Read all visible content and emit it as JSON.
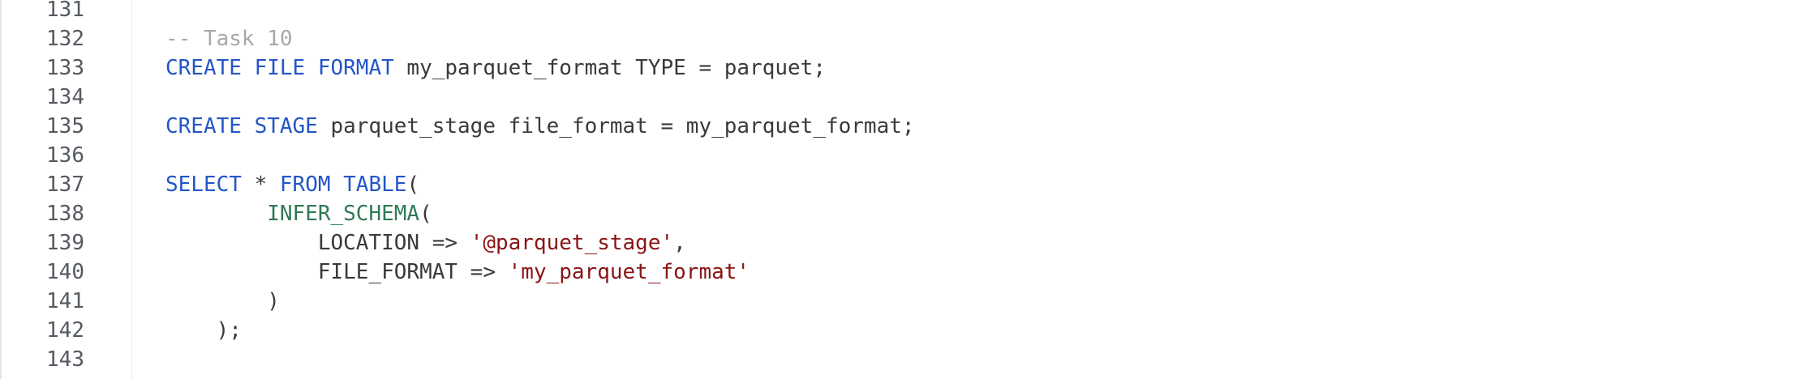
{
  "editor": {
    "lines": [
      {
        "number": "131",
        "tokens": []
      },
      {
        "number": "132",
        "tokens": [
          {
            "type": "cm",
            "text": "-- Task 10"
          }
        ]
      },
      {
        "number": "133",
        "tokens": [
          {
            "type": "kw",
            "text": "CREATE FILE FORMAT"
          },
          {
            "type": "id",
            "text": " my_parquet_format TYPE = parquet;"
          }
        ]
      },
      {
        "number": "134",
        "tokens": []
      },
      {
        "number": "135",
        "tokens": [
          {
            "type": "kw",
            "text": "CREATE STAGE"
          },
          {
            "type": "id",
            "text": " parquet_stage file_format = my_parquet_format;"
          }
        ]
      },
      {
        "number": "136",
        "tokens": []
      },
      {
        "number": "137",
        "tokens": [
          {
            "type": "kw",
            "text": "SELECT"
          },
          {
            "type": "id",
            "text": " * "
          },
          {
            "type": "kw",
            "text": "FROM TABLE"
          },
          {
            "type": "id",
            "text": "("
          }
        ]
      },
      {
        "number": "138",
        "tokens": [
          {
            "type": "id",
            "text": "        "
          },
          {
            "type": "fn",
            "text": "INFER_SCHEMA"
          },
          {
            "type": "id",
            "text": "("
          }
        ]
      },
      {
        "number": "139",
        "tokens": [
          {
            "type": "id",
            "text": "            LOCATION => "
          },
          {
            "type": "str",
            "text": "'@parquet_stage'"
          },
          {
            "type": "id",
            "text": ","
          }
        ]
      },
      {
        "number": "140",
        "tokens": [
          {
            "type": "id",
            "text": "            FILE_FORMAT => "
          },
          {
            "type": "str",
            "text": "'my_parquet_format'"
          }
        ]
      },
      {
        "number": "141",
        "tokens": [
          {
            "type": "id",
            "text": "        )"
          }
        ]
      },
      {
        "number": "142",
        "tokens": [
          {
            "type": "id",
            "text": "    );"
          }
        ]
      },
      {
        "number": "143",
        "tokens": []
      }
    ]
  },
  "colors": {
    "keyword": "#2456c8",
    "function": "#2f7a55",
    "string": "#8a1414",
    "comment": "#a8a8a8",
    "identifier": "#3a3a3a",
    "line_number": "#555a61"
  }
}
